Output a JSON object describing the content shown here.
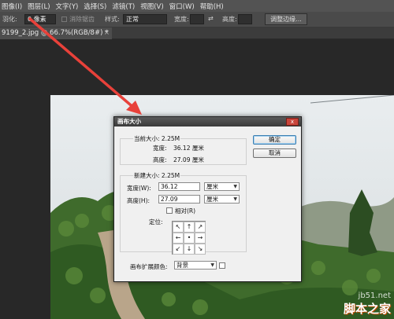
{
  "menu": [
    "图像(I)",
    "图层(L)",
    "文字(Y)",
    "选择(S)",
    "滤镜(T)",
    "视图(V)",
    "窗口(W)",
    "帮助(H)"
  ],
  "options": {
    "feather_label": "羽化:",
    "feather_value": "0 像素",
    "antialias_label": "消除锯齿",
    "style_label": "样式:",
    "style_value": "正常",
    "width_label": "宽度:",
    "height_label": "高度:",
    "refine_edge_label": "调整边缘..."
  },
  "document_tab": {
    "title": "9199_2.jpg @ 66.7%(RGB/8#) *",
    "close": "×"
  },
  "dialog": {
    "title": "画布大小",
    "close": "x",
    "current_size": {
      "legend": "当前大小: 2.25M",
      "width_label": "宽度:",
      "width_value": "36.12 厘米",
      "height_label": "高度:",
      "height_value": "27.09 厘米"
    },
    "new_size": {
      "legend": "新建大小: 2.25M",
      "width_label": "宽度(W):",
      "width_value": "36.12",
      "width_unit": "厘米",
      "height_label": "高度(H):",
      "height_value": "27.09",
      "height_unit": "厘米",
      "relative_label": "相对(R)",
      "anchor_label": "定位:",
      "anchor_arrows": [
        "↖",
        "↑",
        "↗",
        "←",
        "•",
        "→",
        "↙",
        "↓",
        "↘"
      ]
    },
    "ok_label": "确定",
    "cancel_label": "取消",
    "extension_color_label": "画布扩展颜色:",
    "extension_color_value": "背景"
  },
  "watermark": {
    "site": "jb51.net",
    "name": "脚本之家"
  },
  "colors": {
    "menubar": "#535353",
    "workspace": "#282828",
    "annotation_arrow": "#e8413a",
    "dialog_bg": "#f0f0f0"
  }
}
